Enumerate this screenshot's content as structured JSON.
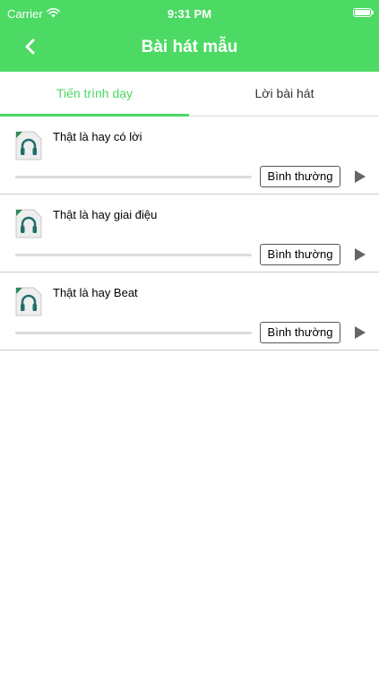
{
  "status_bar": {
    "carrier": "Carrier",
    "time": "9:31 PM"
  },
  "header": {
    "title": "Bài hát mẫu",
    "back_icon": "chevron-left-icon",
    "background_color": "#4cd964"
  },
  "tabs": [
    {
      "label": "Tiến trình dạy",
      "active": true
    },
    {
      "label": "Lời bài hát",
      "active": false
    }
  ],
  "songs": [
    {
      "title": "Thật là hay có lời",
      "speed_label": "Bình thường",
      "progress": 0
    },
    {
      "title": "Thật là hay giai điệu",
      "speed_label": "Bình thường",
      "progress": 0
    },
    {
      "title": "Thật là hay Beat",
      "speed_label": "Bình thường",
      "progress": 0
    }
  ],
  "accent_color": "#4cd964"
}
